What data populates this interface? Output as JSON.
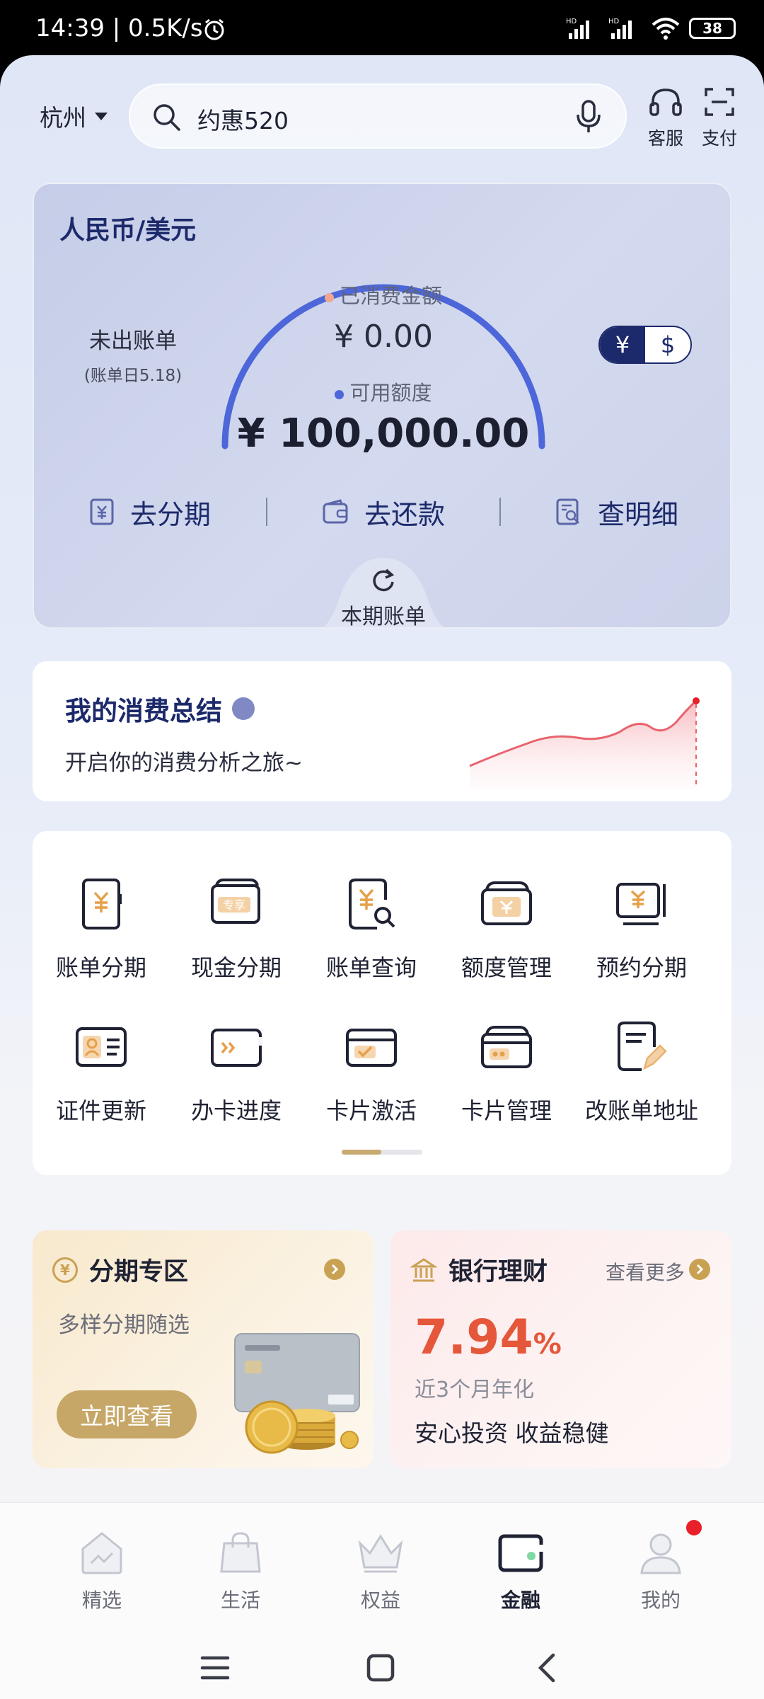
{
  "status_bar": {
    "time": "14:39 | 0.5K/s",
    "battery": "38",
    "signal1": "HD",
    "signal2": "HD"
  },
  "header": {
    "city": "杭州",
    "search_text": "约惠520",
    "service_label": "客服",
    "pay_label": "支付"
  },
  "card": {
    "title": "人民币/美元",
    "unbilled_label": "未出账单",
    "bill_day": "(账单日5.18)",
    "spent_label": "已消费金额",
    "spent_value": "¥ 0.00",
    "available_label": "可用额度",
    "available_value": "¥ 100,000.00",
    "currency_rmb": "¥",
    "currency_usd": "$",
    "actions": {
      "installment": "去分期",
      "repay": "去还款",
      "details": "查明细"
    },
    "bill_tab": "本期账单"
  },
  "summary": {
    "title": "我的消费总结",
    "subtitle": "开启你的消费分析之旅~"
  },
  "services": [
    {
      "label": "账单分期",
      "icon": "bill-installment-icon"
    },
    {
      "label": "现金分期",
      "icon": "cash-installment-icon"
    },
    {
      "label": "账单查询",
      "icon": "bill-query-icon"
    },
    {
      "label": "额度管理",
      "icon": "limit-management-icon"
    },
    {
      "label": "预约分期",
      "icon": "scheduled-installment-icon"
    },
    {
      "label": "证件更新",
      "icon": "id-update-icon"
    },
    {
      "label": "办卡进度",
      "icon": "card-progress-icon"
    },
    {
      "label": "卡片激活",
      "icon": "card-activation-icon"
    },
    {
      "label": "卡片管理",
      "icon": "card-management-icon"
    },
    {
      "label": "改账单地址",
      "icon": "bill-address-icon"
    }
  ],
  "promo_installment": {
    "title": "分期专区",
    "subtitle": "多样分期随选",
    "button": "立即查看",
    "icon_glyph": "¥"
  },
  "promo_wealth": {
    "title": "银行理财",
    "more": "查看更多",
    "rate_number": "7.94",
    "rate_unit": "%",
    "rate_label": "近3个月年化",
    "slogan": "安心投资 收益稳健"
  },
  "tabbar": [
    {
      "label": "精选",
      "icon": "home-icon"
    },
    {
      "label": "生活",
      "icon": "shopping-bag-icon"
    },
    {
      "label": "权益",
      "icon": "crown-icon"
    },
    {
      "label": "金融",
      "icon": "wallet-icon",
      "active": true
    },
    {
      "label": "我的",
      "icon": "user-icon",
      "badge": true
    }
  ],
  "colors": {
    "primary": "#1c2a6b",
    "gauge": "#4d66d9",
    "gold": "#c6a767",
    "rate": "#e5573a",
    "spent_dot": "#f0a690",
    "available_dot": "#4d66d9"
  }
}
